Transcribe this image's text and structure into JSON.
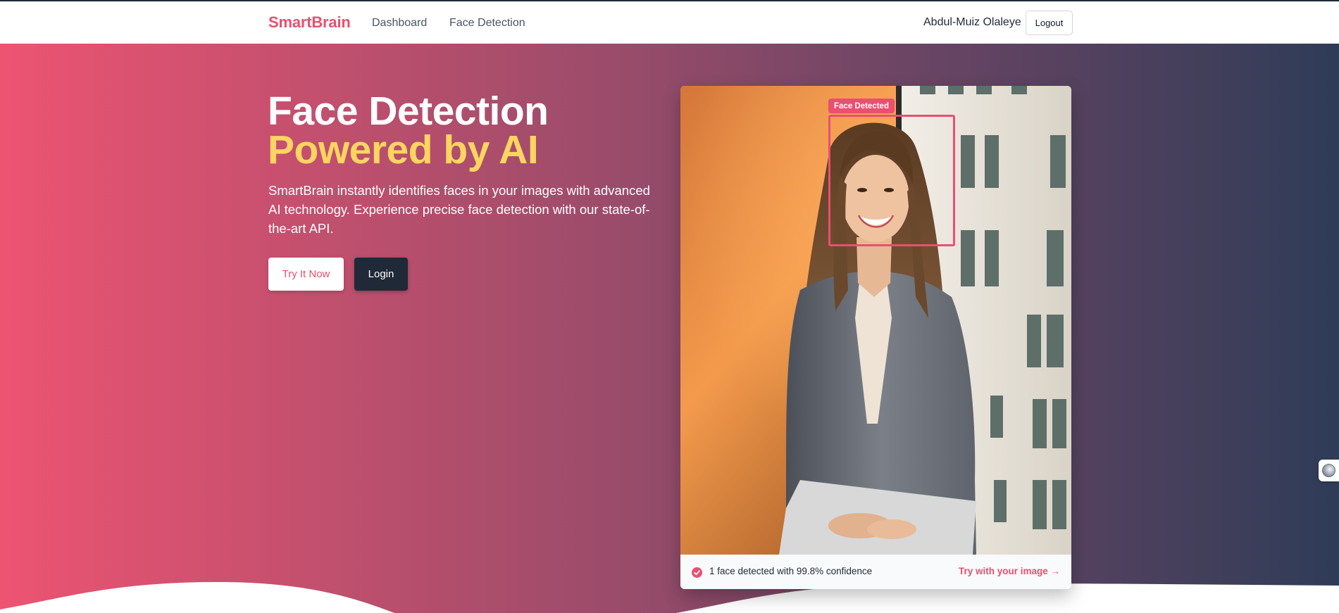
{
  "nav": {
    "brand": "SmartBrain",
    "links": [
      "Dashboard",
      "Face Detection"
    ],
    "user_name": "Abdul-Muiz Olaleye",
    "logout_label": "Logout"
  },
  "hero": {
    "title_line1": "Face Detection",
    "title_line2": "Powered by AI",
    "description": "SmartBrain instantly identifies faces in your images with advanced AI technology. Experience precise face detection with our state-of-the-art API.",
    "primary_button": "Try It Now",
    "secondary_button": "Login"
  },
  "demo": {
    "face_label": "Face Detected",
    "status_text": "1 face detected with 99.8% confidence",
    "cta_link": "Try with your image →"
  },
  "colors": {
    "brand": "#e8506f",
    "accent_yellow": "#fcd561",
    "dark": "#1f2937",
    "gradient_start": "#ec5472",
    "gradient_end": "#2f3c57"
  },
  "icons": [
    "check-circle-icon",
    "accessibility-widget-icon"
  ]
}
